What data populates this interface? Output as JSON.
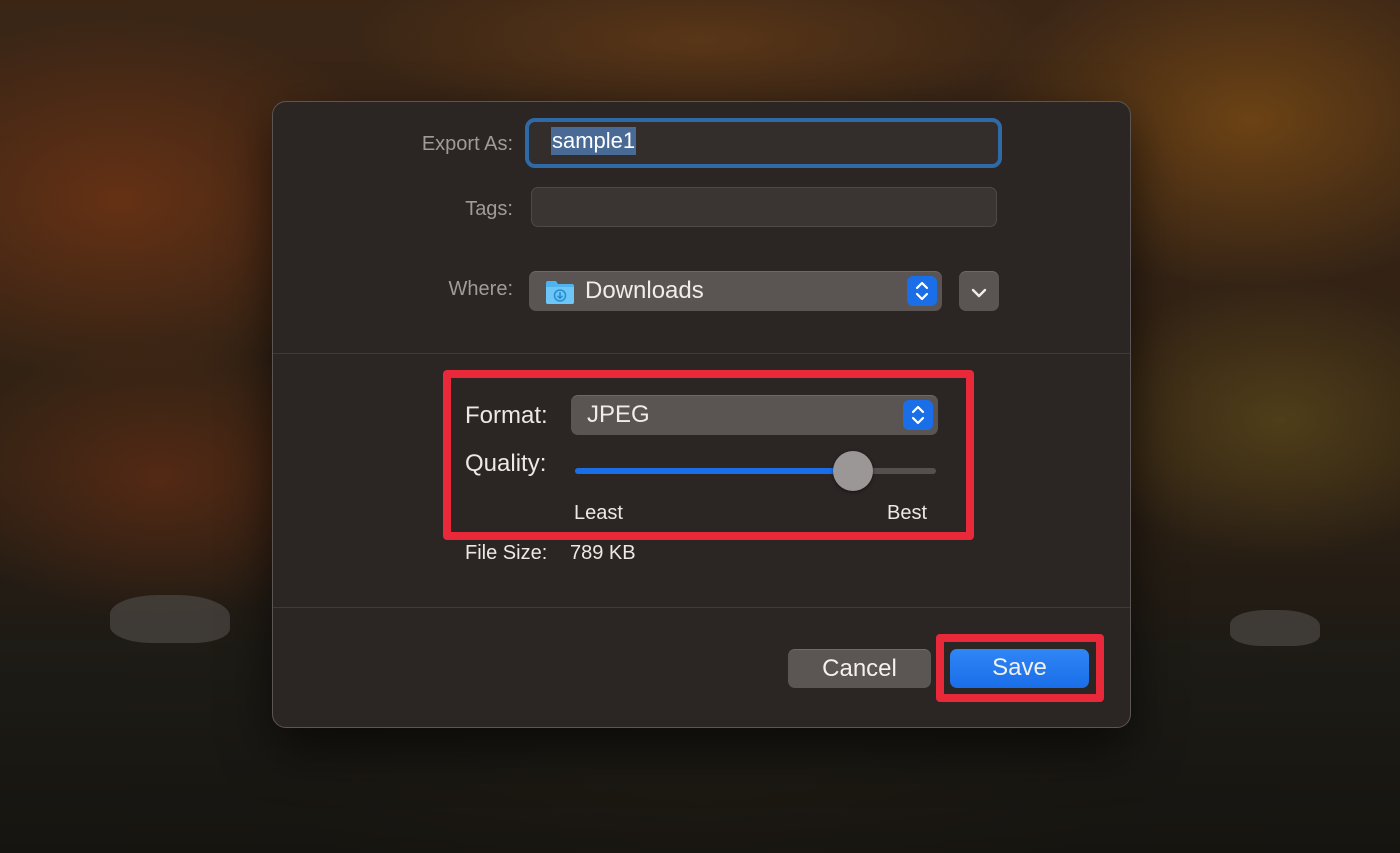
{
  "dialog": {
    "export_as_label": "Export As:",
    "export_as_value": "sample1",
    "tags_label": "Tags:",
    "tags_value": "",
    "where_label": "Where:",
    "where_value": "Downloads",
    "where_icon": "downloads-folder-icon",
    "format_label": "Format:",
    "format_value": "JPEG",
    "quality_label": "Quality:",
    "quality_level": 0.77,
    "quality_min_label": "Least",
    "quality_max_label": "Best",
    "file_size_label": "File Size:",
    "file_size_value": "789 KB",
    "cancel_label": "Cancel",
    "save_label": "Save"
  },
  "colors": {
    "accent": "#1a6ee8",
    "highlight": "#e9283a",
    "dialog_bg": "#2b2524"
  }
}
